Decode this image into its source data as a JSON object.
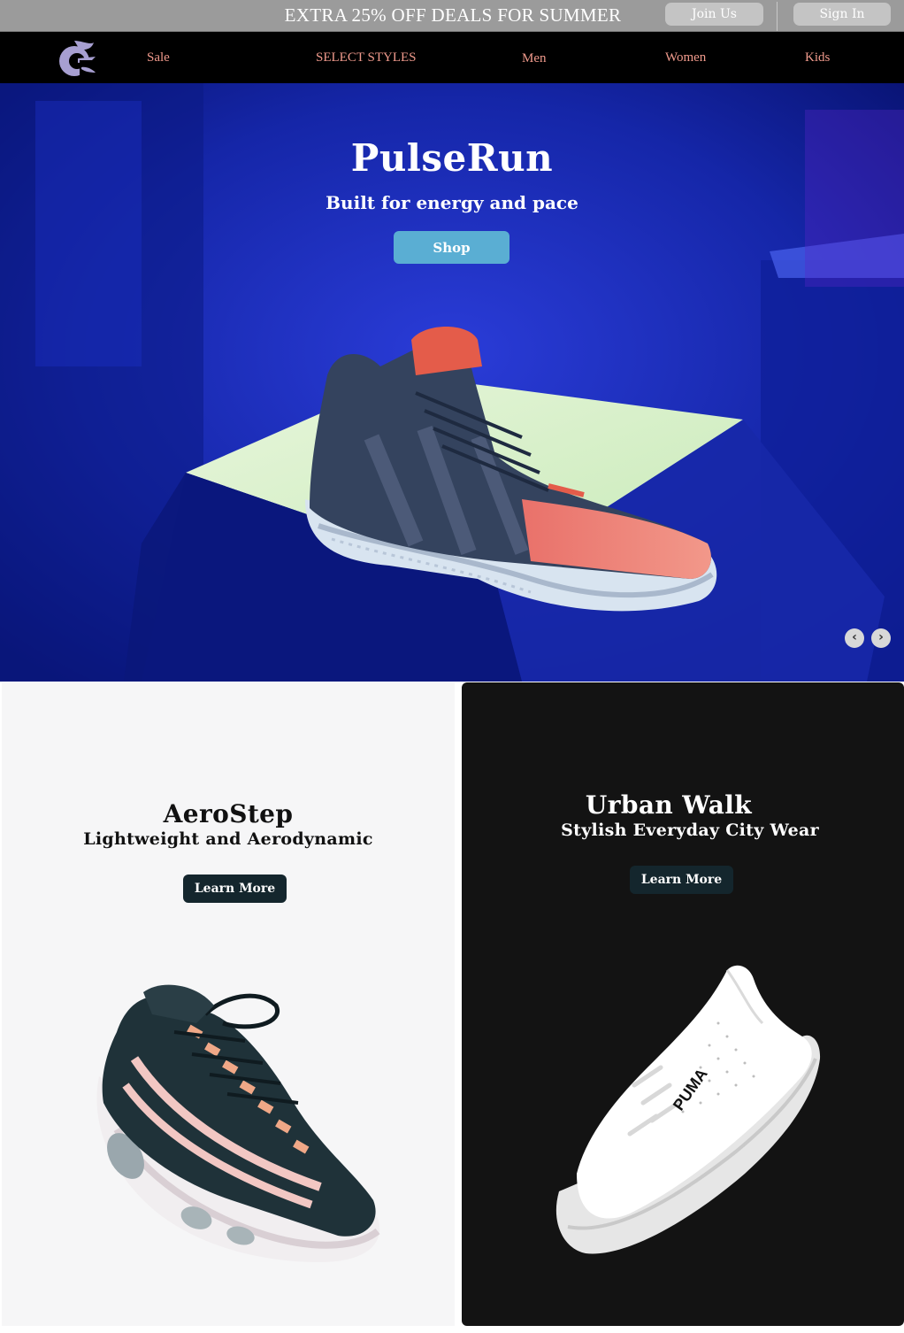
{
  "promo": {
    "text": "EXTRA 25% OFF DEALS FOR SUMMER",
    "join_label": "Join Us",
    "signin_label": "Sign In"
  },
  "nav": {
    "logo_icon": "flame-c-logo-icon",
    "items": [
      {
        "label": "Sale"
      },
      {
        "label": "SELECT STYLES"
      },
      {
        "label": "Men"
      },
      {
        "label": "Women"
      },
      {
        "label": "Kids"
      }
    ]
  },
  "hero": {
    "title": "PulseRun",
    "subtitle": "Built for energy and pace",
    "cta_label": "Shop",
    "prev_icon": "‹",
    "next_icon": "›"
  },
  "cards": [
    {
      "title": "AeroStep",
      "subtitle": "Lightweight and Aerodynamic",
      "cta_label": "Learn More"
    },
    {
      "title": "Urban Walk",
      "subtitle": "Stylish Everyday City Wear",
      "cta_label": "Learn More",
      "shoe_brand": "PUMA"
    }
  ],
  "colors": {
    "promo_bg": "#9b9b9b",
    "nav_bg": "#000000",
    "nav_link": "#f09a8c",
    "shop_button": "#5aaed3",
    "learn_button": "#14262d",
    "hero_bg": "#10208f"
  }
}
